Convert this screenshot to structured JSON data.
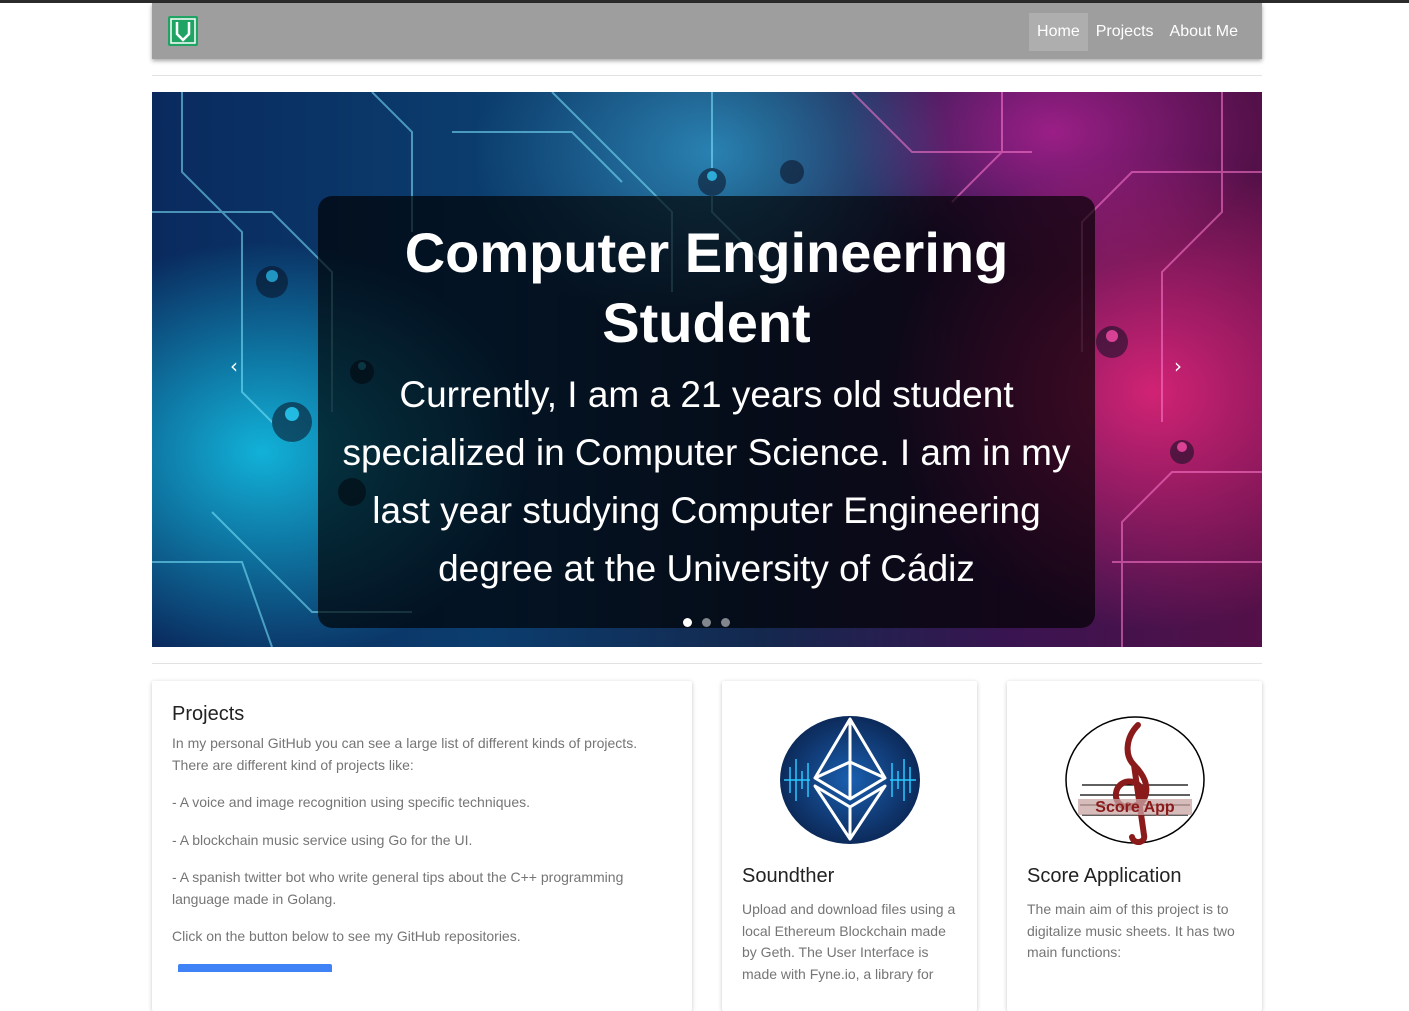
{
  "navbar": {
    "logo_letter": "V",
    "links": [
      "Home",
      "Projects",
      "About Me"
    ],
    "active": "Home"
  },
  "hero": {
    "title": "Computer Engineering Student",
    "text": "Currently, I am a 21 years old student specialized in Computer Science. I am in my last year studying Computer Engineering degree at the University of Cádiz",
    "prev_icon": "‹",
    "next_icon": "›"
  },
  "projects_card": {
    "title": "Projects",
    "intro": "In my personal GitHub you can see a large list of different kinds of projects. There are different kind of projects like:",
    "items": [
      "- A voice and image recognition using specific techniques.",
      "- A blockchain music service using Go for the UI.",
      "- A spanish twitter bot who write general tips about the C++ programming language made in Golang."
    ],
    "footer": "Click on the button below to see my GitHub repositories."
  },
  "soundther_card": {
    "title": "Soundther",
    "text": "Upload and download files using a local Ethereum Blockchain made by Geth. The User Interface is made with Fyne.io, a library for"
  },
  "score_card": {
    "title": "Score Application",
    "text": "The main aim of this project is to digitalize music sheets. It has two main functions:",
    "logo_text": "Score App"
  },
  "colors": {
    "navbar": "#9e9e9e",
    "logo": "#1fa463",
    "button": "#3f82f5"
  }
}
